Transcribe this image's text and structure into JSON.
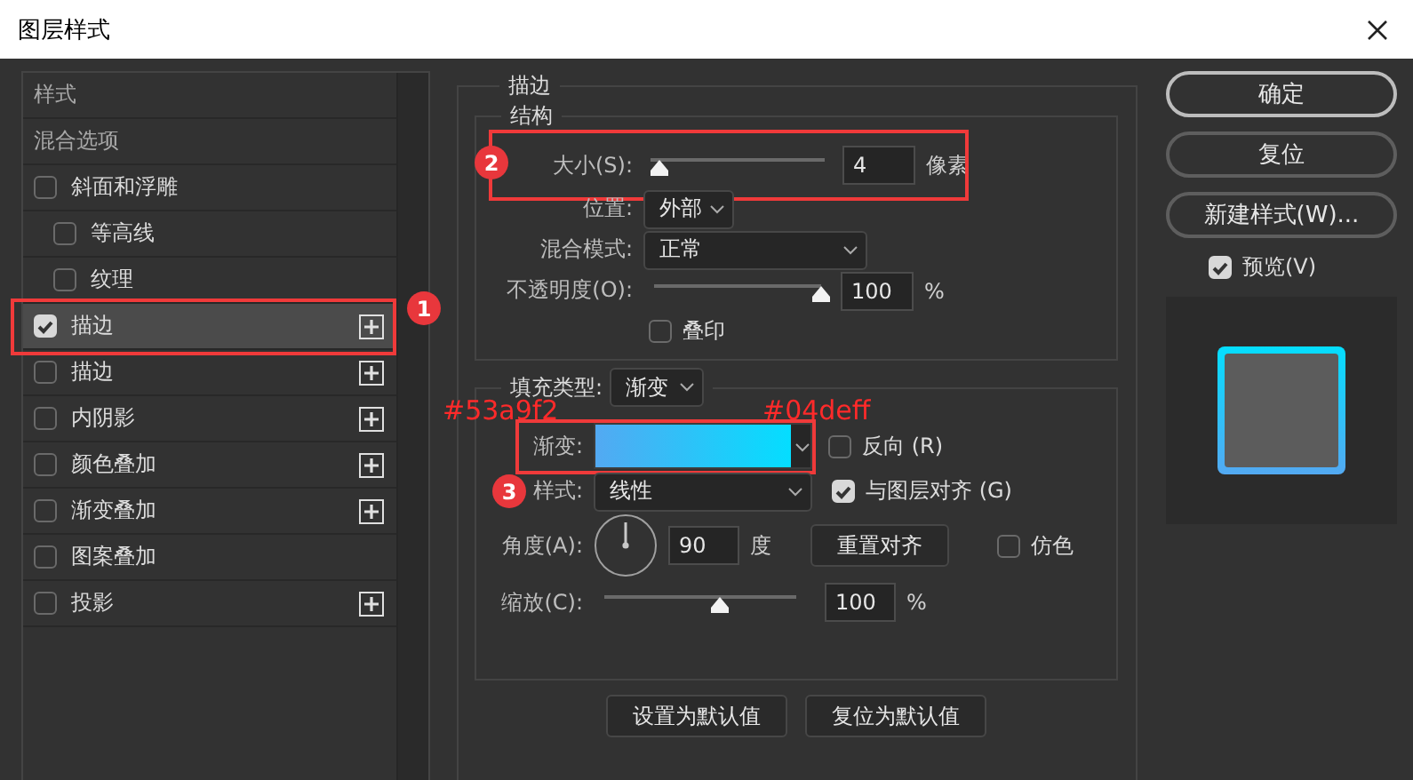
{
  "window": {
    "title": "图层样式"
  },
  "sidebar": {
    "items": [
      {
        "kind": "header",
        "label": "样式",
        "selected": false
      },
      {
        "kind": "header",
        "label": "混合选项",
        "selected": false
      },
      {
        "kind": "effect",
        "label": "斜面和浮雕",
        "checked": false,
        "selected": false,
        "addable": false,
        "children": [
          {
            "kind": "effect",
            "label": "等高线",
            "checked": false,
            "selected": false,
            "addable": false
          },
          {
            "kind": "effect",
            "label": "纹理",
            "checked": false,
            "selected": false,
            "addable": false
          }
        ]
      },
      {
        "kind": "effect",
        "label": "描边",
        "checked": true,
        "selected": true,
        "addable": true,
        "callout": "1"
      },
      {
        "kind": "effect",
        "label": "描边",
        "checked": false,
        "selected": false,
        "addable": true
      },
      {
        "kind": "effect",
        "label": "内阴影",
        "checked": false,
        "selected": false,
        "addable": true
      },
      {
        "kind": "effect",
        "label": "颜色叠加",
        "checked": false,
        "selected": false,
        "addable": true
      },
      {
        "kind": "effect",
        "label": "渐变叠加",
        "checked": false,
        "selected": false,
        "addable": true
      },
      {
        "kind": "effect",
        "label": "图案叠加",
        "checked": false,
        "selected": false,
        "addable": false
      },
      {
        "kind": "effect",
        "label": "投影",
        "checked": false,
        "selected": false,
        "addable": true
      }
    ]
  },
  "stroke": {
    "title": "描边",
    "structure": {
      "title": "结构",
      "size": {
        "label": "大小(S):",
        "level": 0.05,
        "value": "4",
        "unit": "像素",
        "callout": "2"
      },
      "position": {
        "label": "位置:",
        "value": "外部"
      },
      "blend_mode": {
        "label": "混合模式:",
        "value": "正常"
      },
      "opacity": {
        "label": "不透明度(O):",
        "level": 1,
        "value": "100",
        "unit": "%"
      },
      "overprint": {
        "label": "叠印",
        "checked": false
      }
    },
    "fill": {
      "label": "填充类型:",
      "value": "渐变",
      "gradient": {
        "label": "渐变:",
        "start_note": "#53a9f2",
        "end_note": "#04deff",
        "callout": "3"
      },
      "reverse": {
        "label": "反向 (R)",
        "checked": false
      },
      "style": {
        "label": "样式:",
        "value": "线性"
      },
      "align": {
        "label": "与图层对齐 (G)",
        "checked": true
      },
      "angle": {
        "label": "角度(A):",
        "value": "90",
        "unit": "度"
      },
      "reset_button": "重置对齐",
      "dither": {
        "label": "仿色",
        "checked": false
      },
      "scale": {
        "label": "缩放(C):",
        "level": 0.6,
        "value": "100",
        "unit": "%"
      }
    },
    "buttons": [
      "设置为默认值",
      "复位为默认值"
    ]
  },
  "actions": {
    "buttons": [
      "确定",
      "复位",
      "新建样式(W)..."
    ],
    "preview": {
      "label": "预览(V)",
      "checked": true
    }
  }
}
